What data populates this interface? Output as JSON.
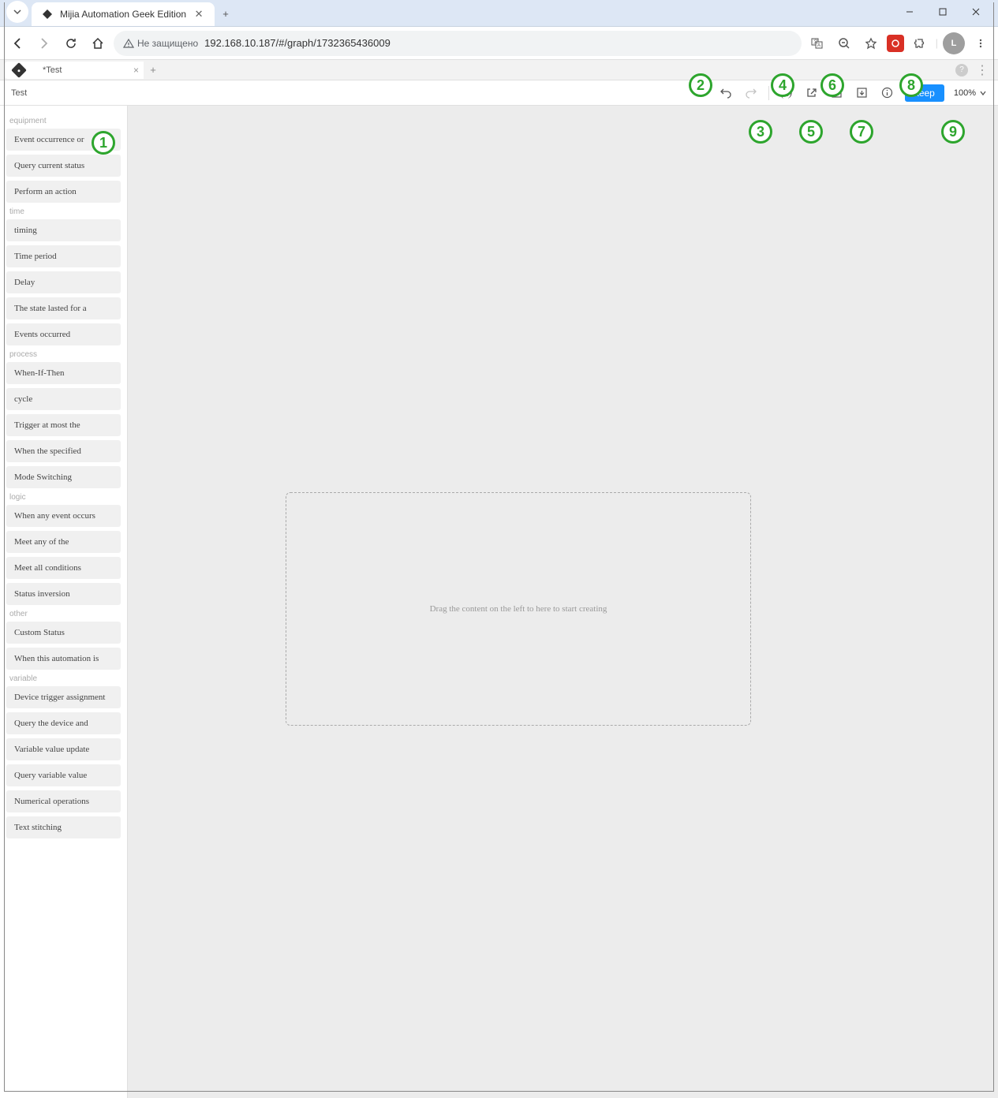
{
  "browser": {
    "tab_title": "Mijia Automation Geek Edition",
    "security_label": "Не защищено",
    "url": "192.168.10.187/#/graph/1732365436009",
    "profile_initial": "L"
  },
  "app_tabs": {
    "current": "*Test"
  },
  "editor": {
    "title": "Test",
    "keep_label": "keep",
    "zoom": "100%"
  },
  "sidebar": {
    "groups": [
      {
        "label": "equipment",
        "items": [
          "Event occurrence or",
          "Query current status",
          "Perform an action"
        ]
      },
      {
        "label": "time",
        "items": [
          "timing",
          "Time period",
          "Delay",
          "The state lasted for a",
          "Events occurred"
        ]
      },
      {
        "label": "process",
        "items": [
          "When-If-Then",
          "cycle",
          "Trigger at most the",
          "When the specified",
          "Mode Switching"
        ]
      },
      {
        "label": "logic",
        "items": [
          "When any event occurs",
          "Meet any of the",
          "Meet all conditions",
          "Status inversion"
        ]
      },
      {
        "label": "other",
        "items": [
          "Custom Status",
          "When this automation is"
        ]
      },
      {
        "label": "variable",
        "items": [
          "Device trigger assignment",
          "Query the device and",
          "Variable value update",
          "Query variable value",
          "Numerical operations",
          "Text stitching"
        ]
      }
    ]
  },
  "canvas": {
    "drop_hint": "Drag the content on the left to here to start creating"
  },
  "badges": [
    "①",
    "②",
    "③",
    "④",
    "⑤",
    "⑥",
    "⑦",
    "⑧",
    "⑨"
  ]
}
